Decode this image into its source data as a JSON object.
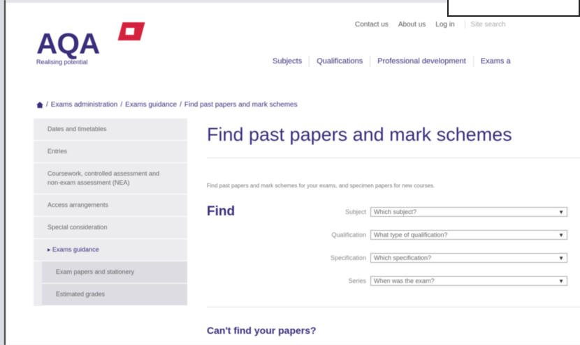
{
  "brand": {
    "logo_text": "AQA",
    "tagline": "Realising potential"
  },
  "utility_nav": {
    "contact": "Contact us",
    "about": "About us",
    "login": "Log in",
    "search_placeholder": "Site search"
  },
  "main_nav": [
    "Subjects",
    "Qualifications",
    "Professional development",
    "Exams a"
  ],
  "breadcrumb": [
    "Exams administration",
    "Exams guidance",
    "Find past papers and mark schemes"
  ],
  "sidebar": [
    {
      "label": "Dates and timetables"
    },
    {
      "label": "Entries"
    },
    {
      "label": "Coursework, controlled assessment and non-exam assessment (NEA)"
    },
    {
      "label": "Access arrangements"
    },
    {
      "label": "Special consideration"
    },
    {
      "label": "Exams guidance"
    },
    {
      "label": "Exam papers and stationery"
    },
    {
      "label": "Estimated grades"
    }
  ],
  "page": {
    "title": "Find past papers and mark schemes",
    "intro": "Find past papers and mark schemes for your exams, and specimen papers for new courses.",
    "find_label": "Find",
    "filters": [
      {
        "label": "Subject",
        "value": "Which subject?"
      },
      {
        "label": "Qualification",
        "value": "What type of qualification?"
      },
      {
        "label": "Specification",
        "value": "Which specification?"
      },
      {
        "label": "Series",
        "value": "When was the exam?"
      }
    ],
    "cant_find": "Can't find your papers?"
  },
  "colors": {
    "brand_purple": "#3a2e7b",
    "brand_red": "#d4213d",
    "sidebar_bg": "#ececef"
  }
}
